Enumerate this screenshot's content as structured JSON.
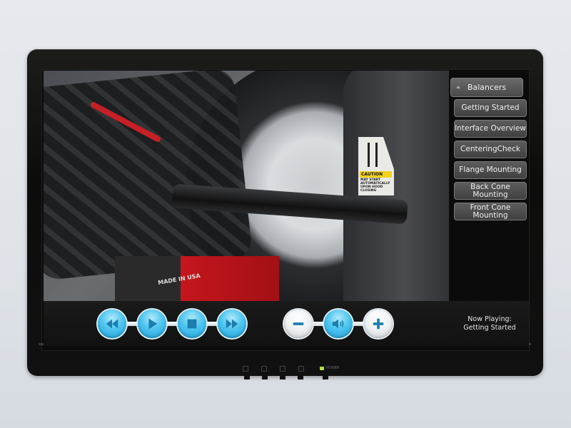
{
  "video": {
    "caution_label": "CAUTION",
    "caution_note": "MAY START AUTOMATICALLY UPON HOOD CLOSING",
    "made_label": "MADE IN USA"
  },
  "menu": {
    "header": "Balancers",
    "items": [
      {
        "label": "Getting Started"
      },
      {
        "label": "Interface Overview"
      },
      {
        "label": "CenteringCheck"
      },
      {
        "label": "Flange Mounting"
      },
      {
        "label": "Back Cone Mounting"
      },
      {
        "label": "Front Cone Mounting"
      }
    ]
  },
  "playback": {
    "buttons": [
      {
        "icon": "rewind-icon"
      },
      {
        "icon": "play-icon"
      },
      {
        "icon": "stop-icon"
      },
      {
        "icon": "fast-forward-icon"
      }
    ]
  },
  "volume": {
    "buttons": [
      {
        "icon": "volume-down-icon"
      },
      {
        "icon": "speaker-icon"
      },
      {
        "icon": "volume-up-icon"
      }
    ]
  },
  "now_playing": {
    "label": "Now Playing:",
    "title": "Getting Started"
  },
  "hardware": {
    "power_label": "POWER"
  },
  "colors": {
    "accent_blue": "#4cc4ef",
    "icon_blue": "#1a7fae",
    "led_green": "#b4e23c"
  }
}
